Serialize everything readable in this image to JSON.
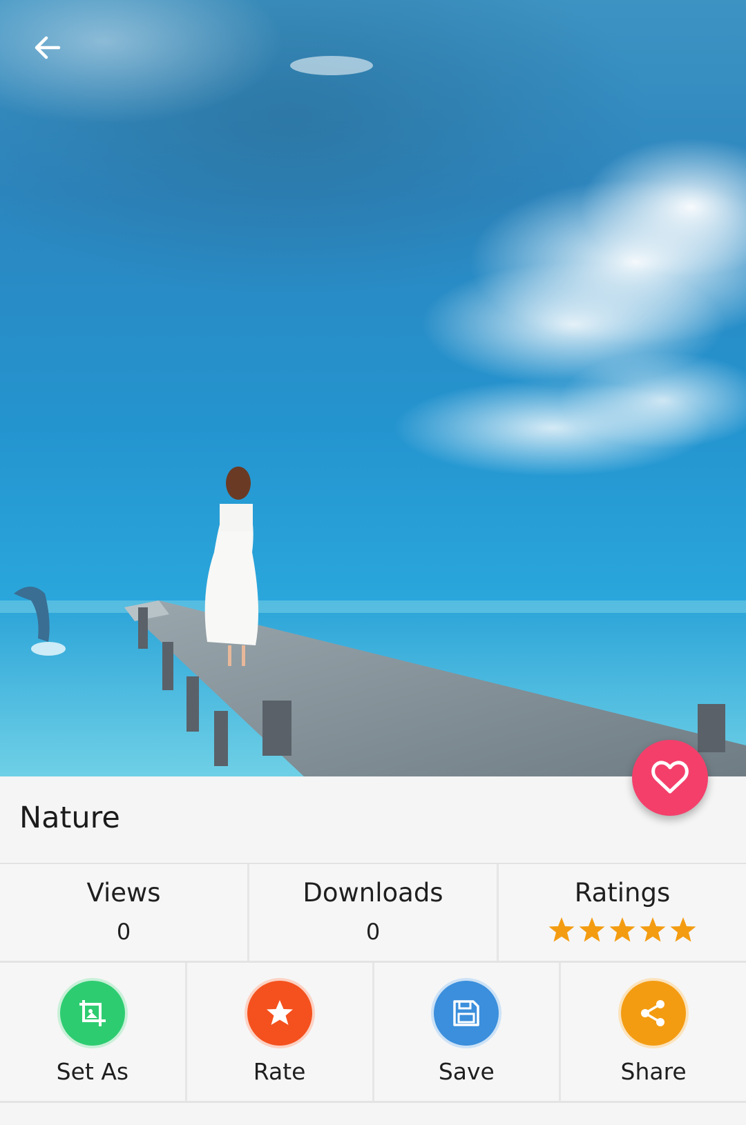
{
  "wallpaper": {
    "title": "Nature"
  },
  "stats": {
    "views_label": "Views",
    "views_value": "0",
    "downloads_label": "Downloads",
    "downloads_value": "0",
    "ratings_label": "Ratings",
    "ratings_stars": 5
  },
  "actions": {
    "set_as_label": "Set As",
    "rate_label": "Rate",
    "save_label": "Save",
    "share_label": "Share"
  },
  "icons": {
    "back": "arrow-back-icon",
    "favorite": "heart-icon",
    "set_as": "crop-icon",
    "rate": "star-icon",
    "save": "floppy-disk-icon",
    "share": "share-icon"
  },
  "colors": {
    "favorite_fab": "#f43f6b",
    "set_as": "#2ecc71",
    "rate": "#f4511e",
    "save": "#3b8fdc",
    "share": "#f39c12",
    "star": "#f39c12"
  }
}
